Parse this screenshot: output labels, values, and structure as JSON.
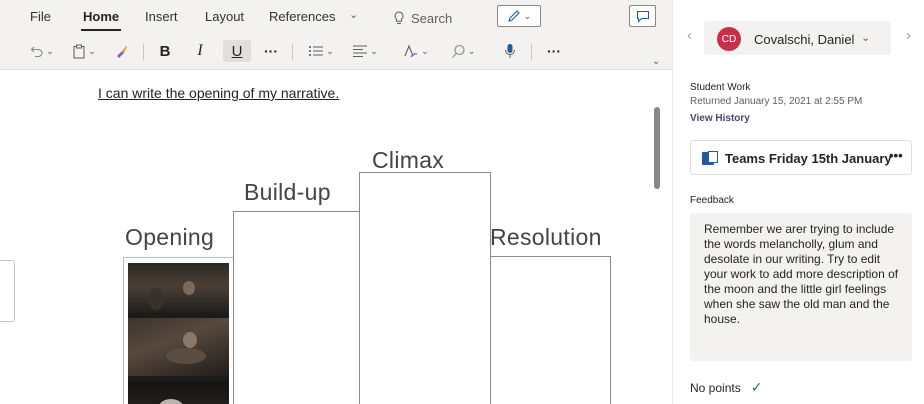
{
  "ribbon": {
    "tabs": [
      {
        "label": "File"
      },
      {
        "label": "Home"
      },
      {
        "label": "Insert"
      },
      {
        "label": "Layout"
      },
      {
        "label": "References"
      }
    ],
    "search_label": "Search",
    "toolbar": {
      "bold": "B",
      "italic": "I",
      "underline": "U",
      "more1": "···",
      "more2": "···"
    }
  },
  "document": {
    "heading": "I can write the opening of my narrative.",
    "stages": [
      {
        "label": "Opening"
      },
      {
        "label": "Build-up"
      },
      {
        "label": "Climax"
      },
      {
        "label": "Resolution"
      }
    ]
  },
  "panel": {
    "student": {
      "initials": "CD",
      "name": "Covalschi, Daniel",
      "avatar_color": "#c4314b"
    },
    "student_work_title": "Student Work",
    "returned_text": "Returned January 15, 2021 at 2:55 PM",
    "view_history": "View History",
    "file_name": "Teams Friday 15th January",
    "file_more": "•••",
    "feedback_title": "Feedback",
    "feedback_text": "Remember we arer trying to include the words melancholly, glum and desolate in our writing. Try to edit your work to add more description of the moon and the little girl feelings when she saw the old man and the house.",
    "points_text": "No points",
    "check_color": "#237b4b"
  }
}
